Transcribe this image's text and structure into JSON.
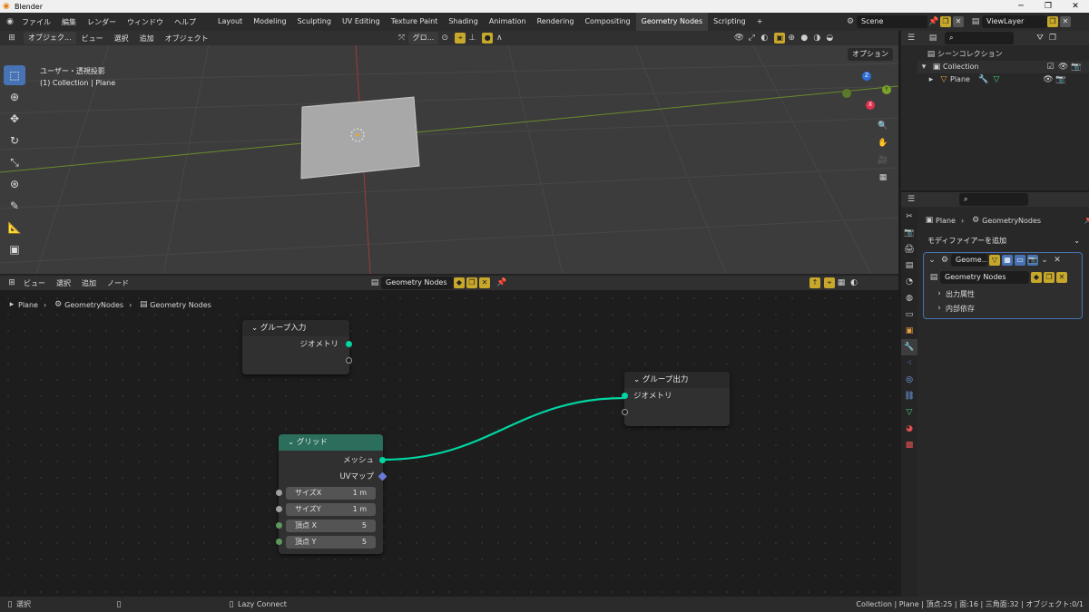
{
  "window": {
    "title": "Blender",
    "minimize": "─",
    "maximize": "❐",
    "close": "✕"
  },
  "menu": [
    "ファイル",
    "編集",
    "レンダー",
    "ウィンドウ",
    "ヘルプ"
  ],
  "workspaces": [
    "Layout",
    "Modeling",
    "Sculpting",
    "UV Editing",
    "Texture Paint",
    "Shading",
    "Animation",
    "Rendering",
    "Compositing",
    "Geometry Nodes",
    "Scripting"
  ],
  "active_workspace": "Geometry Nodes",
  "add_tab": "+",
  "scene": {
    "name": "Scene",
    "view_layer": "ViewLayer"
  },
  "viewport": {
    "mode": "オブジェク...",
    "menus": [
      "ビュー",
      "選択",
      "追加",
      "オブジェクト"
    ],
    "transform_orientation": "グロ...",
    "options": "オプション",
    "view_label": "ユーザー・透視投影",
    "collection_label": "(1) Collection | Plane",
    "gizmo": {
      "z": "Z",
      "y": "Y",
      "x": "X"
    }
  },
  "node_editor": {
    "menus": [
      "ビュー",
      "選択",
      "追加",
      "ノード"
    ],
    "tree_name": "Geometry Nodes",
    "breadcrumb": [
      "Plane",
      "GeometryNodes",
      "Geometry Nodes"
    ],
    "nodes": {
      "group_input": {
        "title": "グループ入力",
        "socket": "ジオメトリ"
      },
      "group_output": {
        "title": "グループ出力",
        "socket": "ジオメトリ"
      },
      "grid": {
        "title": "グリッド",
        "out_mesh": "メッシュ",
        "out_uv": "UVマップ",
        "fields": [
          {
            "label": "サイズX",
            "value": "1 m"
          },
          {
            "label": "サイズY",
            "value": "1 m"
          },
          {
            "label": "頂点 X",
            "value": "5"
          },
          {
            "label": "頂点 Y",
            "value": "5"
          }
        ]
      }
    }
  },
  "outliner": {
    "root": "シーンコレクション",
    "collection": "Collection",
    "object": "Plane"
  },
  "properties": {
    "breadcrumb": [
      "Plane",
      "GeometryNodes"
    ],
    "add_modifier": "モディファイアーを追加",
    "modifier_name": "Geome...",
    "node_group": "Geometry Nodes",
    "panels": [
      "出力属性",
      "内部依存"
    ]
  },
  "status": {
    "left": "選択",
    "middle": "Lazy Connect",
    "right": "Collection | Plane | 頂点:25 | 面:16 | 三角面:32 | オブジェクト:0/1"
  },
  "colors": {
    "accent": "#4772b3",
    "geometry_socket": "#00d6a3",
    "grid_header": "#2b6e5b",
    "highlight": "#c8a82a"
  }
}
